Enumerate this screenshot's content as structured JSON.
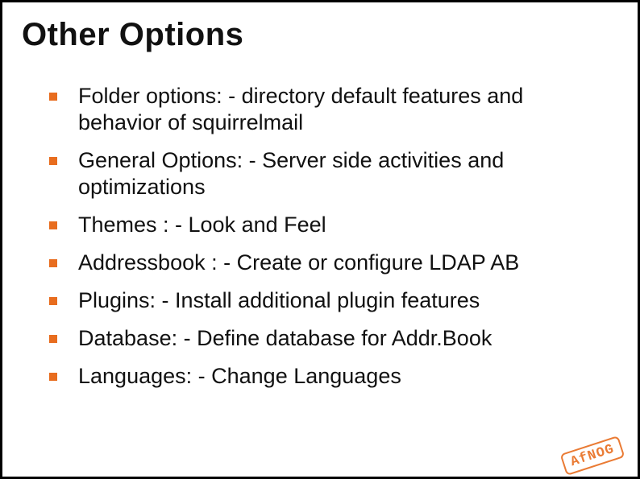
{
  "title": "Other Options",
  "bullets": [
    "Folder options: - directory default features and behavior of squirrelmail",
    "General Options: - Server side activities and optimizations",
    "Themes : - Look and Feel",
    "Addressbook : - Create or configure LDAP AB",
    "Plugins: - Install additional plugin features",
    "Database: - Define database for Addr.Book",
    "Languages: - Change Languages"
  ],
  "stamp": "AfNOG",
  "colors": {
    "accent": "#e86d1f"
  }
}
